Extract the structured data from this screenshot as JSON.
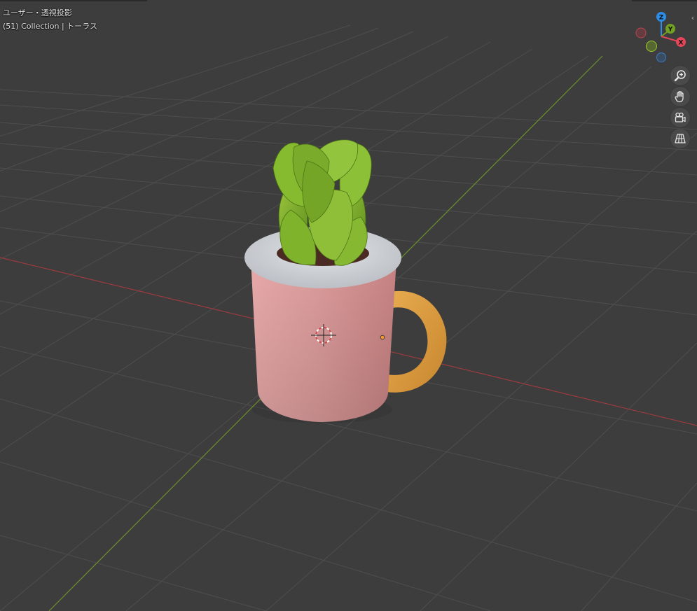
{
  "viewport": {
    "view_name": "ユーザー・透視投影",
    "collection_info": "(51) Collection | トーラス"
  },
  "gizmo": {
    "z_label": "Z",
    "y_label": "Y",
    "x_label": "X",
    "colors": {
      "x": "#e34656",
      "y": "#72a023",
      "z": "#2c8ee8",
      "neg_x": "#8b3a42",
      "neg_y": "#6b8a2a",
      "neg_z": "#365a82"
    }
  },
  "navigation": {
    "zoom_icon": "zoom-icon",
    "pan_icon": "hand-icon",
    "camera_icon": "camera-icon",
    "ortho_icon": "grid-icon"
  },
  "colors": {
    "background": "#3d3d3d",
    "grid": "#4e4e4e",
    "x_axis": "#9c3b3f",
    "y_axis": "#6d8f2c",
    "mug": "#d99a9b",
    "mug_rim": "#c9cdd2",
    "handle": "#d7993f",
    "leaves": "#7fae2e"
  },
  "sidebar_toggle": "‹"
}
